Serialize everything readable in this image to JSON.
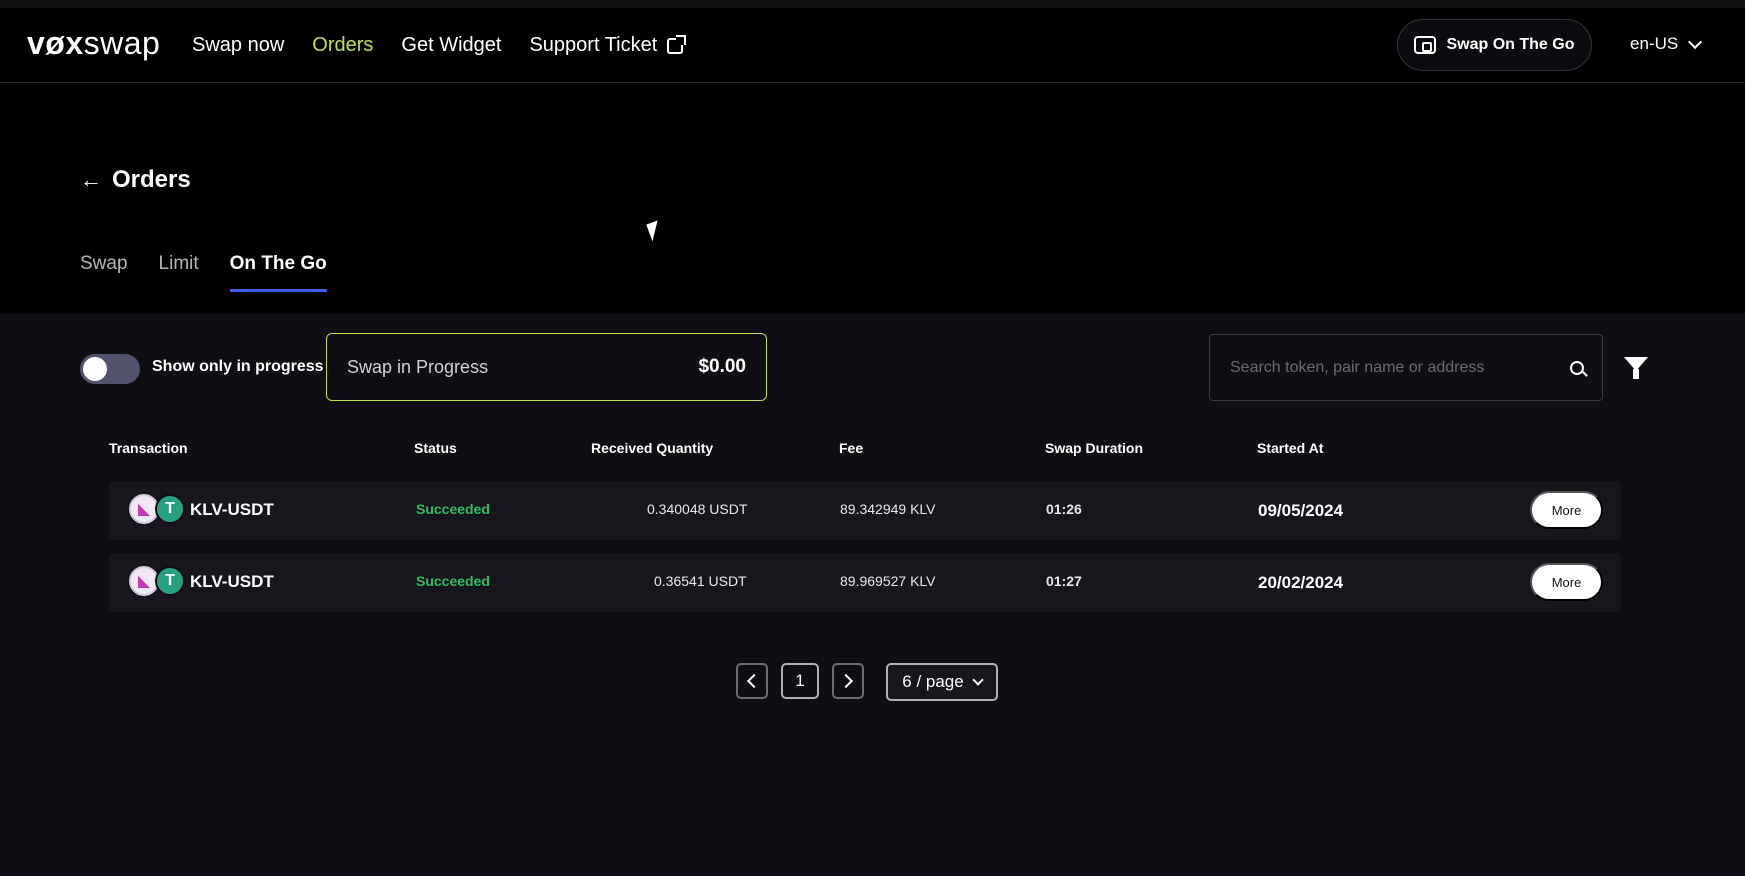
{
  "header": {
    "logo_pre": "vøx",
    "logo_post": "swap",
    "nav": [
      {
        "label": "Swap now"
      },
      {
        "label": "Orders"
      },
      {
        "label": "Get Widget"
      },
      {
        "label": "Support Ticket"
      }
    ],
    "cta_label": "Swap On The Go",
    "language": "en-US"
  },
  "page": {
    "back_icon": "←",
    "title": "Orders",
    "tabs": [
      {
        "label": "Swap"
      },
      {
        "label": "Limit"
      },
      {
        "label": "On The Go"
      }
    ]
  },
  "filters": {
    "toggle_label": "Show only in progress",
    "progress_label": "Swap in Progress",
    "progress_value": "$0.00",
    "search_placeholder": "Search token, pair name or address"
  },
  "table": {
    "columns": [
      "Transaction",
      "Status",
      "Received Quantity",
      "Fee",
      "Swap Duration",
      "Started At"
    ],
    "rows": [
      {
        "pair": "KLV-USDT",
        "status": "Succeeded",
        "received": "0.340048 USDT",
        "fee": "89.342949 KLV",
        "duration": "01:26",
        "started": "09/05/2024",
        "action": "More"
      },
      {
        "pair": "KLV-USDT",
        "status": "Succeeded",
        "received": "0.36541 USDT",
        "fee": "89.969527 KLV",
        "duration": "01:27",
        "started": "20/02/2024",
        "action": "More"
      }
    ]
  },
  "pagination": {
    "current_page": "1",
    "per_page": "6 / page"
  },
  "icons": {
    "coin_a_glyph": "◣",
    "coin_b_glyph": "T"
  },
  "colors": {
    "accent_green": "#b9e34b",
    "status_green": "#2ebd62",
    "tab_underline": "#3f5ce4"
  }
}
